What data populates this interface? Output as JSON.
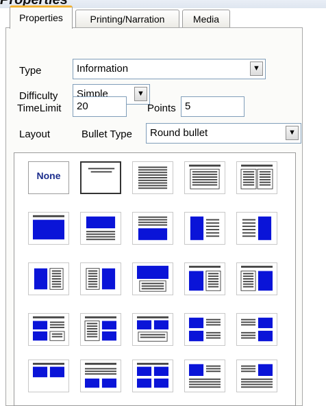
{
  "window": {
    "title": "Properties"
  },
  "tabs": [
    "Properties",
    "Printing/Narration",
    "Media"
  ],
  "form": {
    "type_label": "Type",
    "type_value": "Information",
    "difficulty_label": "Difficulty",
    "difficulty_value": "Simple",
    "timelimit_label": "TimeLimit",
    "timelimit_value": "20",
    "points_label": "Points",
    "points_value": "5",
    "layout_label": "Layout",
    "bullet_label": "Bullet Type",
    "bullet_value": "Round bullet"
  },
  "layouts": {
    "none_label": "None",
    "selected": "title-only",
    "items": [
      "none",
      "title-only",
      "text-lines",
      "bullet-list",
      "two-bullet-lists",
      "title-picture",
      "picture-top-text",
      "text-top-picture",
      "picture-left-text",
      "text-left-picture",
      "picture-left-list",
      "list-left-picture",
      "picture-top-list",
      "list-picture-right-top",
      "list-left-picture-bottom",
      "picture-list-2x2",
      "list-picture-2x2",
      "pictures-top-list",
      "pictures-text-2x2",
      "text-pictures-2x2",
      "two-pictures",
      "text-two-pictures",
      "four-pictures",
      "picture-text-rows",
      "text-picture-rows"
    ]
  },
  "colors": {
    "accent_tab": "#f2b233",
    "picture_blue": "#0a14d8",
    "text_line": "#444444"
  }
}
